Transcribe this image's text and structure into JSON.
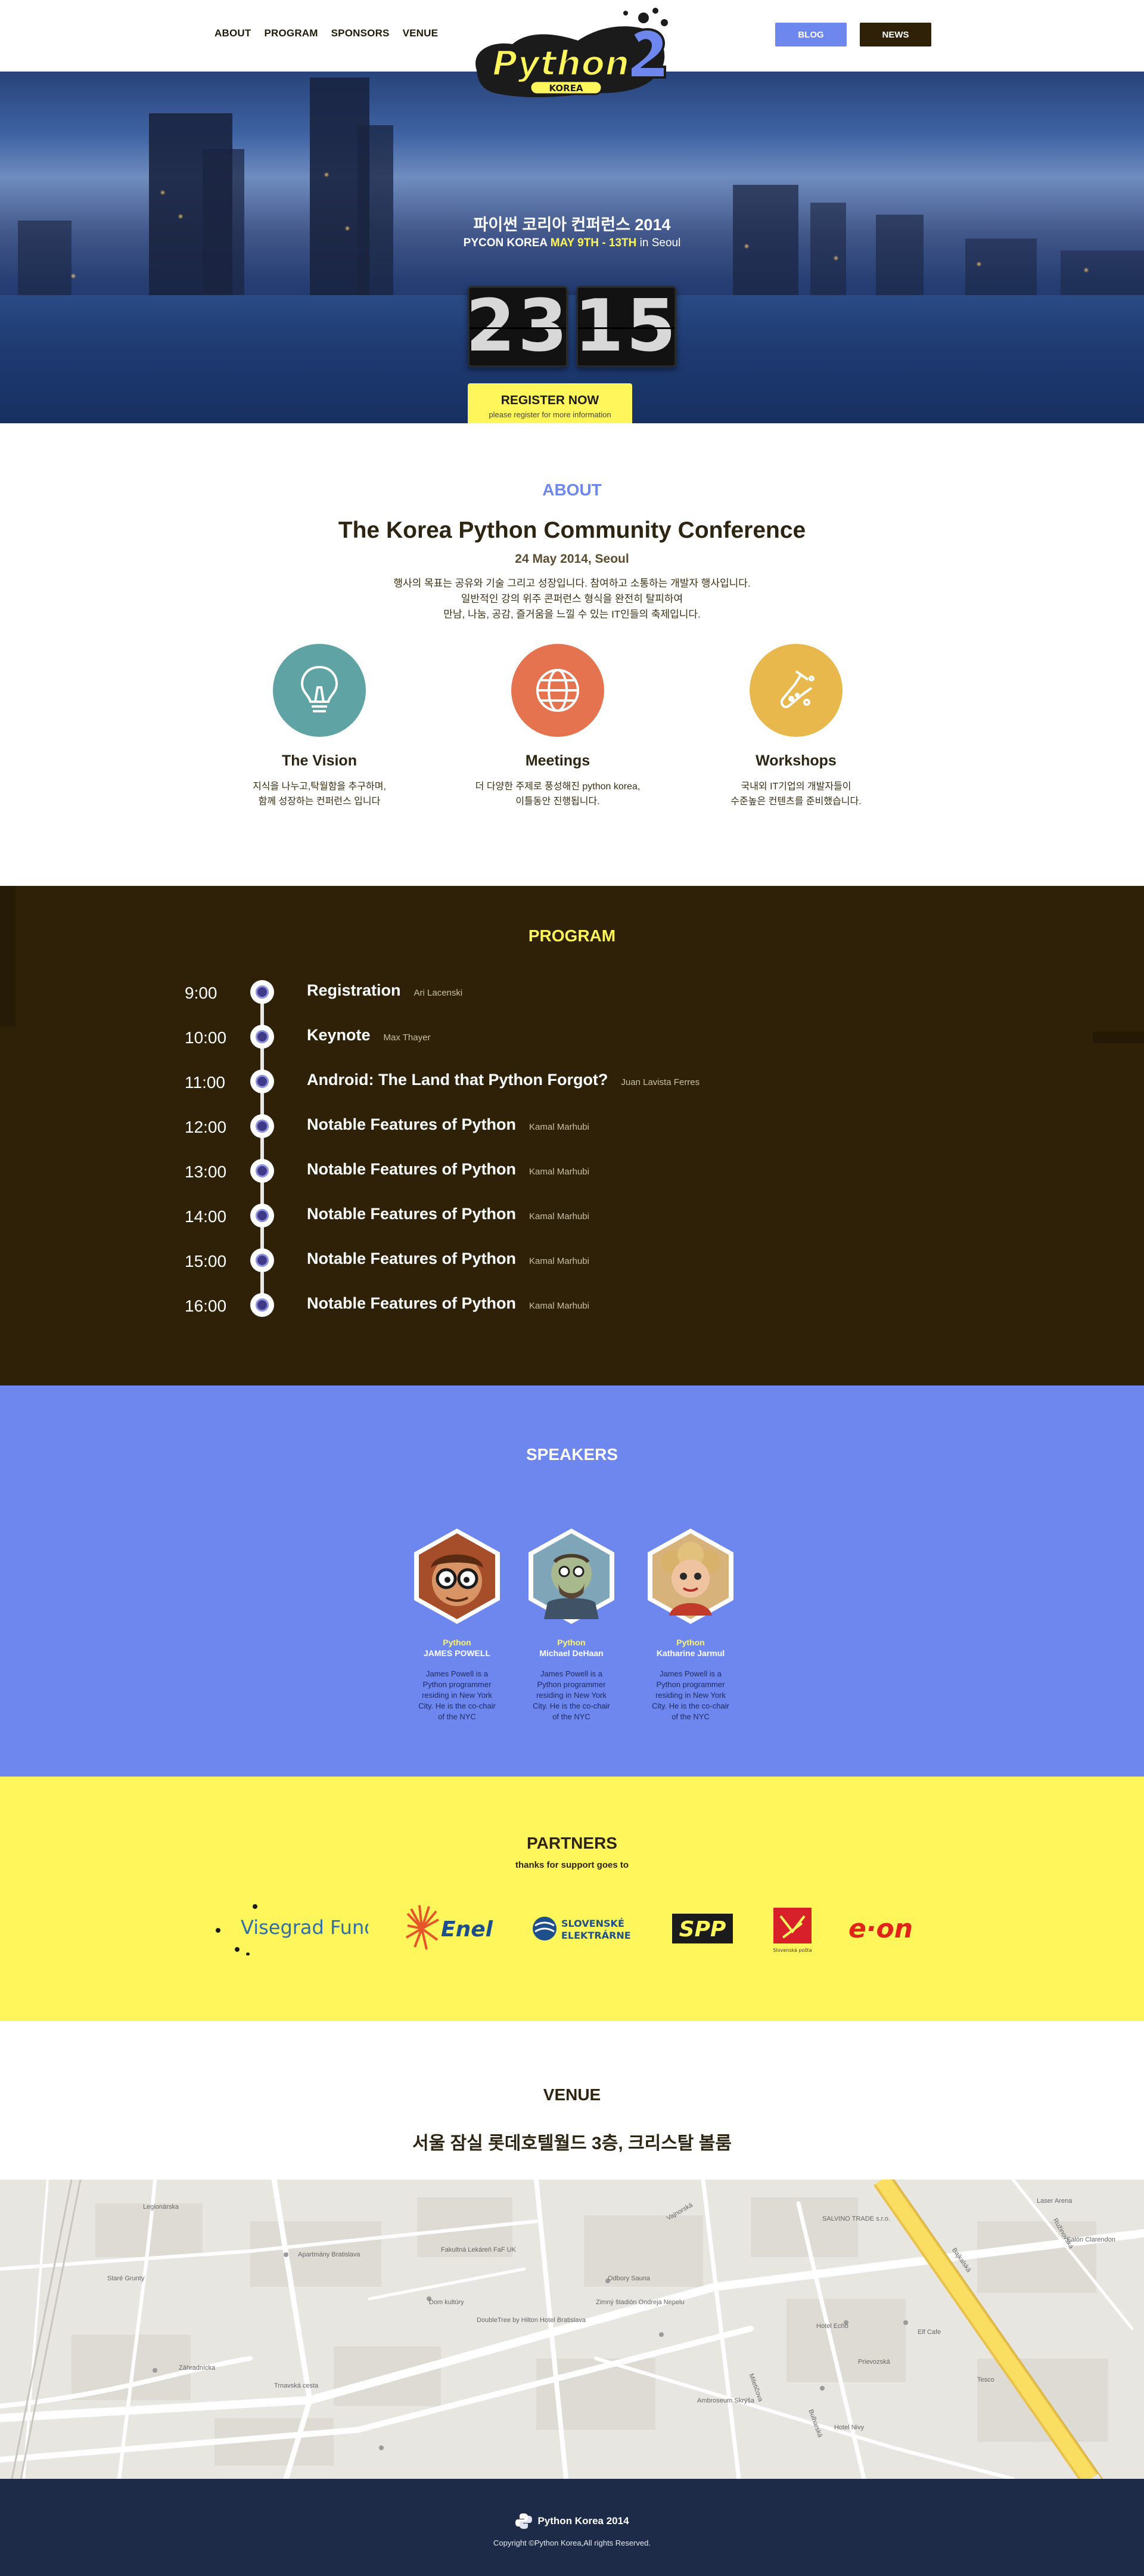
{
  "nav": {
    "items": [
      "ABOUT",
      "PROGRAM",
      "SPONSORS",
      "VENUE"
    ],
    "blog": "BLOG",
    "news": "NEWS"
  },
  "logo": {
    "word": "Python",
    "sub": "KOREA",
    "accent": "#fff65c"
  },
  "hero": {
    "title": "파이썬 코리아 컨퍼런스 2014",
    "sub_prefix": "PYCON KOREA",
    "sub_dates": "MAY 9TH - 13TH",
    "sub_suffix": "in Seoul",
    "counter": [
      "23",
      "15"
    ],
    "register": "REGISTER NOW",
    "register_note": "please register for more information"
  },
  "about": {
    "label": "ABOUT",
    "heading": "The Korea Python Community Conference",
    "date": "24 May 2014, Seoul",
    "desc": [
      "행사의 목표는 공유와 기술 그리고 성장입니다. 참여하고 소통하는 개발자 행사입니다.",
      "일반적인 강의 위주 콘퍼런스 형식을 완전히 탈피하여",
      "만남, 나눔, 공감, 즐거움을 느낄 수 있는 IT인들의 축제입니다."
    ],
    "features": [
      {
        "title": "The Vision",
        "icon": "lightbulb-icon",
        "color": "#5fa3a4",
        "desc": [
          "지식을 나누고,탁월함을 추구하며,",
          "함께 성장하는 컨퍼런스 입니다"
        ]
      },
      {
        "title": "Meetings",
        "icon": "globe-icon",
        "color": "#e57350",
        "desc": [
          "더 다양한 주제로 풍성해진 python korea,",
          "이틀동안 진행됩니다."
        ]
      },
      {
        "title": "Workshops",
        "icon": "flask-icon",
        "color": "#e9b84c",
        "desc": [
          "국내외 IT기업의 개발자들이",
          "수준높은 컨텐츠를 준비했습니다."
        ]
      }
    ]
  },
  "program": {
    "label": "PROGRAM",
    "items": [
      {
        "time": "9:00",
        "talk": "Registration",
        "speaker": "Ari Lacenski"
      },
      {
        "time": "10:00",
        "talk": "Keynote",
        "speaker": "Max Thayer"
      },
      {
        "time": "11:00",
        "talk": "Android: The Land that Python Forgot?",
        "speaker": "Juan Lavista Ferres"
      },
      {
        "time": "12:00",
        "talk": "Notable Features of Python",
        "speaker": "Kamal Marhubi"
      },
      {
        "time": "13:00",
        "talk": "Notable Features of Python",
        "speaker": "Kamal Marhubi"
      },
      {
        "time": "14:00",
        "talk": "Notable Features of Python",
        "speaker": "Kamal Marhubi"
      },
      {
        "time": "15:00",
        "talk": "Notable Features of Python",
        "speaker": "Kamal Marhubi"
      },
      {
        "time": "16:00",
        "talk": "Notable Features of Python",
        "speaker": "Kamal Marhubi"
      }
    ]
  },
  "speakers": {
    "label": "SPEAKERS",
    "items": [
      {
        "cat": "Python",
        "name": "JAMES POWELL",
        "bio": "James Powell is a Python programmer residing in New York City. He is the co-chair of the NYC"
      },
      {
        "cat": "Python",
        "name": "Michael DeHaan",
        "bio": "James Powell is a Python programmer residing in New York City. He is the co-chair of the NYC"
      },
      {
        "cat": "Python",
        "name": "Katharine Jarmul",
        "bio": "James Powell is a Python programmer residing in New York City. He is the co-chair of the NYC"
      }
    ]
  },
  "partners": {
    "label": "PARTNERS",
    "sub": "thanks for support goes to",
    "items": [
      "Visegrad Fund",
      "Enel",
      "SLOVENSKÉ ELEKTRÁRNE",
      "SPP",
      "Slovenská pošta",
      "e·on"
    ]
  },
  "venue": {
    "label": "VENUE",
    "address": "서울 잠실 롯데호텔월드 3층, 크리스탈 볼룸"
  },
  "map": {
    "labels": [
      "Fakultná Lekáreň FaF UK",
      "Apartmány Bratislava",
      "Dom kultúry",
      "Trnavská cesta",
      "Bajkalská",
      "Ružinovská",
      "SALVINO TRADE s.r.o.",
      "Elf Cafe",
      "Odbory Sauna",
      "Tesco",
      "Hotel Nivy",
      "Prievozská",
      "Zimný štadión Ondreja Nepelu",
      "Staré Grunty",
      "Miletičova",
      "Ambroseum Skrýša",
      "Hotel Echo",
      "Bulharská",
      "Laser Arena",
      "Salón Clarendon",
      "DoubleTree by Hilton Hotel Bratislava",
      "Vajnorská",
      "Legionárska",
      "Záhradnícka"
    ]
  },
  "footer": {
    "brand": "Python Korea 2014",
    "copy": "Copyright ©Python Korea,All rights Reserved."
  }
}
